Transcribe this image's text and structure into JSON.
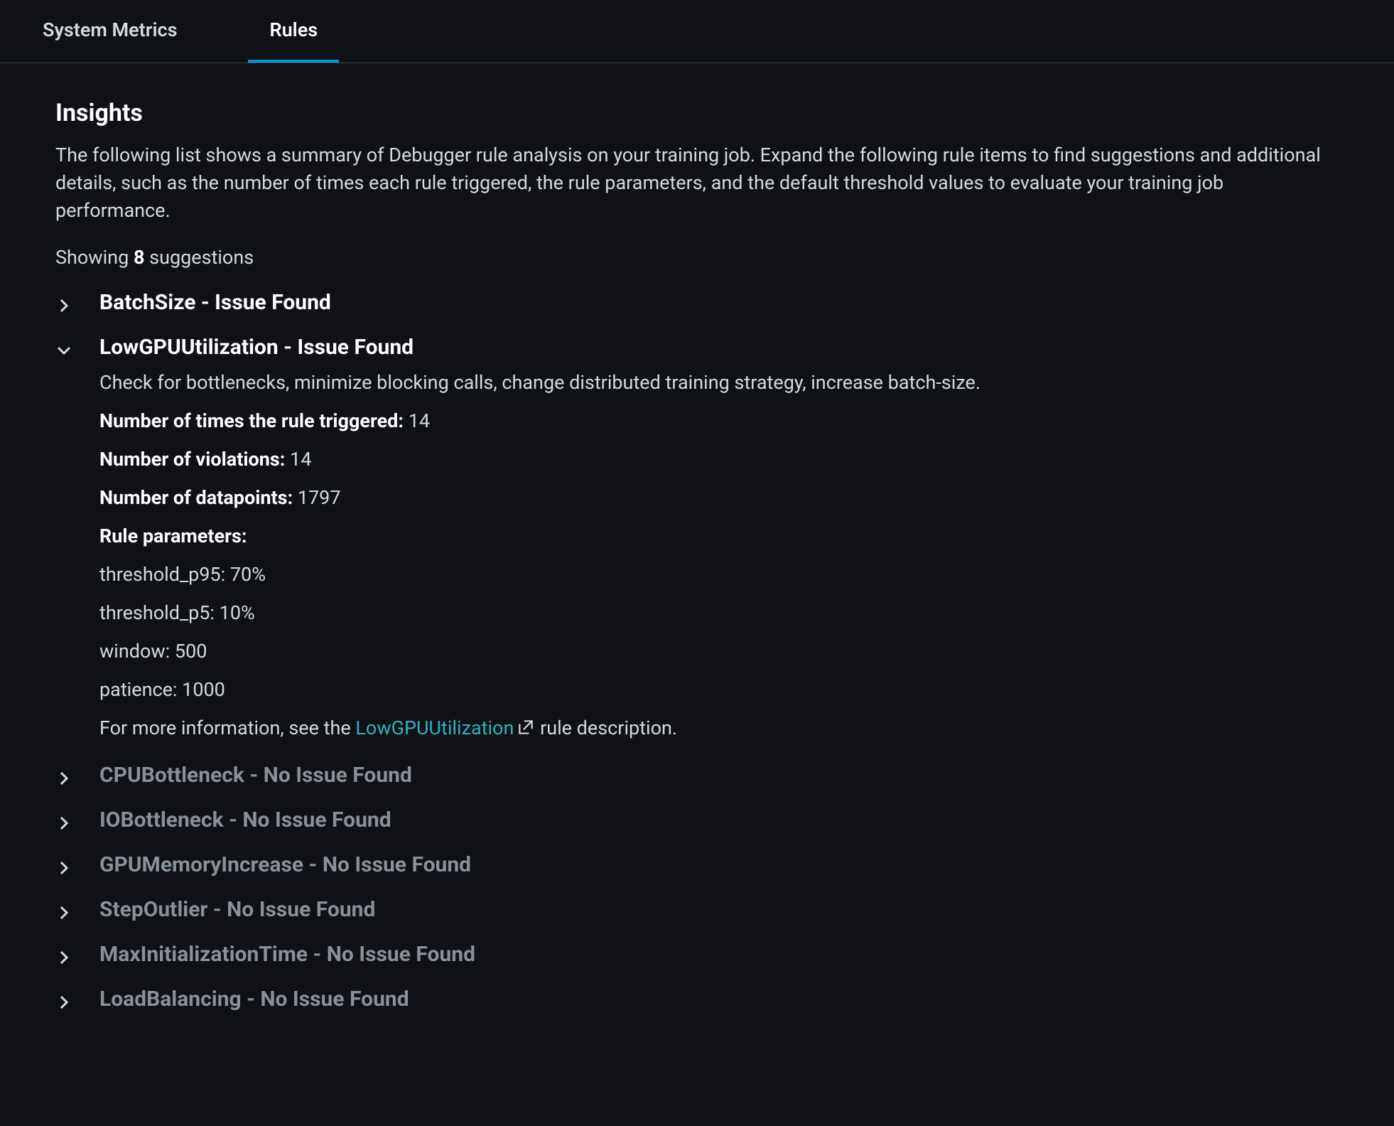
{
  "tabs": {
    "system_metrics": "System Metrics",
    "rules": "Rules"
  },
  "insights": {
    "heading": "Insights",
    "description": "The following list shows a summary of Debugger rule analysis on your training job. Expand the following rule items to find suggestions and additional details, such as the number of times each rule triggered, the rule parameters, and the default threshold values to evaluate your training job performance.",
    "showing_prefix": "Showing ",
    "suggestions_count": "8",
    "showing_suffix": " suggestions"
  },
  "rules": [
    {
      "title": "BatchSize - Issue Found",
      "issue": true,
      "expanded": false
    },
    {
      "title": "LowGPUUtilization - Issue Found",
      "issue": true,
      "expanded": true
    },
    {
      "title": "CPUBottleneck - No Issue Found",
      "issue": false,
      "expanded": false
    },
    {
      "title": "IOBottleneck - No Issue Found",
      "issue": false,
      "expanded": false
    },
    {
      "title": "GPUMemoryIncrease - No Issue Found",
      "issue": false,
      "expanded": false
    },
    {
      "title": "StepOutlier - No Issue Found",
      "issue": false,
      "expanded": false
    },
    {
      "title": "MaxInitializationTime - No Issue Found",
      "issue": false,
      "expanded": false
    },
    {
      "title": "LoadBalancing - No Issue Found",
      "issue": false,
      "expanded": false
    }
  ],
  "expanded_rule": {
    "advice": "Check for bottlenecks, minimize blocking calls, change distributed training strategy, increase batch-size.",
    "triggered_label": "Number of times the rule triggered: ",
    "triggered_value": "14",
    "violations_label": "Number of violations: ",
    "violations_value": "14",
    "datapoints_label": "Number of datapoints: ",
    "datapoints_value": "1797",
    "params_header": "Rule parameters:",
    "params": [
      "threshold_p95: 70%",
      "threshold_p5: 10%",
      "window: 500",
      "patience: 1000"
    ],
    "more_info_prefix": "For more information, see the ",
    "link_text": "LowGPUUtilization",
    "more_info_suffix": " rule description."
  }
}
